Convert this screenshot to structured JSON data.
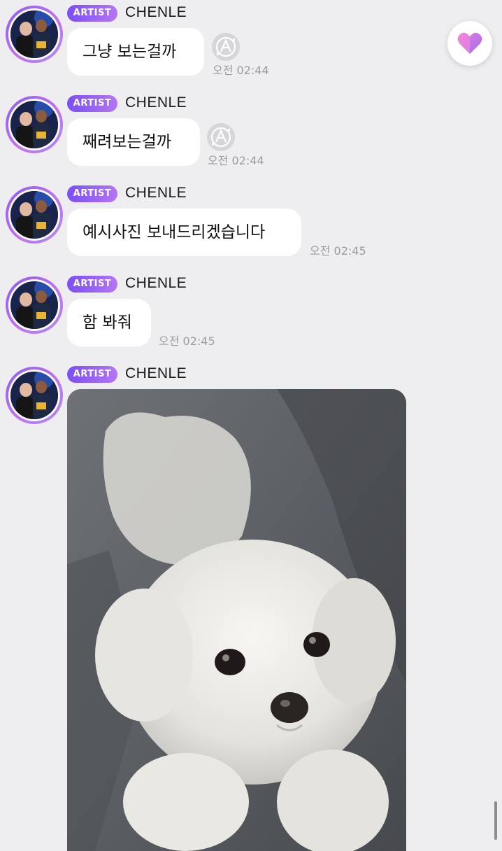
{
  "colors": {
    "background": "#eeeef0",
    "bubble": "#ffffff",
    "badge_gradient_start": "#7b4ef5",
    "badge_gradient_end": "#b476f2",
    "timestamp": "#9c9ca0",
    "heart_gradient_start": "#b18cf7",
    "heart_gradient_end": "#f07bd6"
  },
  "messages": [
    {
      "badge": "ARTIST",
      "sender": "CHENLE",
      "text": "그냥 보는걸까",
      "time": "오전 02:44",
      "translate_icon": "translate-icon"
    },
    {
      "badge": "ARTIST",
      "sender": "CHENLE",
      "text": "째려보는걸까",
      "time": "오전 02:44",
      "translate_icon": "translate-icon"
    },
    {
      "badge": "ARTIST",
      "sender": "CHENLE",
      "text": "예시사진 보내드리겠습니다",
      "time": "오전 02:45"
    },
    {
      "badge": "ARTIST",
      "sender": "CHENLE",
      "text": "함 봐줘",
      "time": "오전 02:45"
    },
    {
      "badge": "ARTIST",
      "sender": "CHENLE",
      "image": "photo of a white fluffy puppy"
    }
  ],
  "floating_button": {
    "icon": "heart-icon"
  }
}
